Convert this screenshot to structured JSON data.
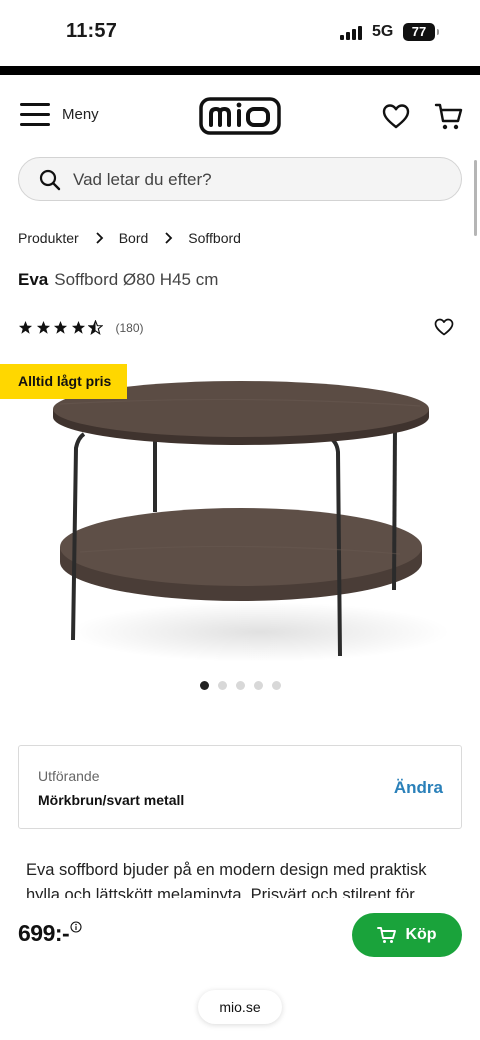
{
  "status_bar": {
    "time": "11:57",
    "network": "5G",
    "battery": "77"
  },
  "header": {
    "menu_label": "Meny",
    "logo_text": "mio"
  },
  "search": {
    "placeholder": "Vad letar du efter?"
  },
  "breadcrumb": [
    "Produkter",
    "Bord",
    "Soffbord"
  ],
  "product": {
    "name": "Eva",
    "subtitle": "Soffbord Ø80 H45 cm",
    "rating_stars": 4.5,
    "review_count": "(180)",
    "badge": "Alltid lågt pris",
    "image_count": 5,
    "active_image": 0,
    "colors": {
      "wood": "#5e4f47",
      "metal": "#2b2b2b"
    }
  },
  "variant": {
    "label": "Utförande",
    "value": "Mörkbrun/svart metall",
    "change_label": "Ändra"
  },
  "description": "Eva soffbord bjuder på en modern design med praktisk hylla och lättskött melaminyta. Prisvärt och stilrent för",
  "buy_bar": {
    "price": "699:-",
    "button_label": "Köp",
    "button_color": "#1aa33b"
  },
  "browser": {
    "url": "mio.se"
  },
  "icons": [
    "menu-icon",
    "heart-icon",
    "cart-icon",
    "search-icon",
    "chevron-right-icon",
    "star-icon",
    "info-icon"
  ]
}
